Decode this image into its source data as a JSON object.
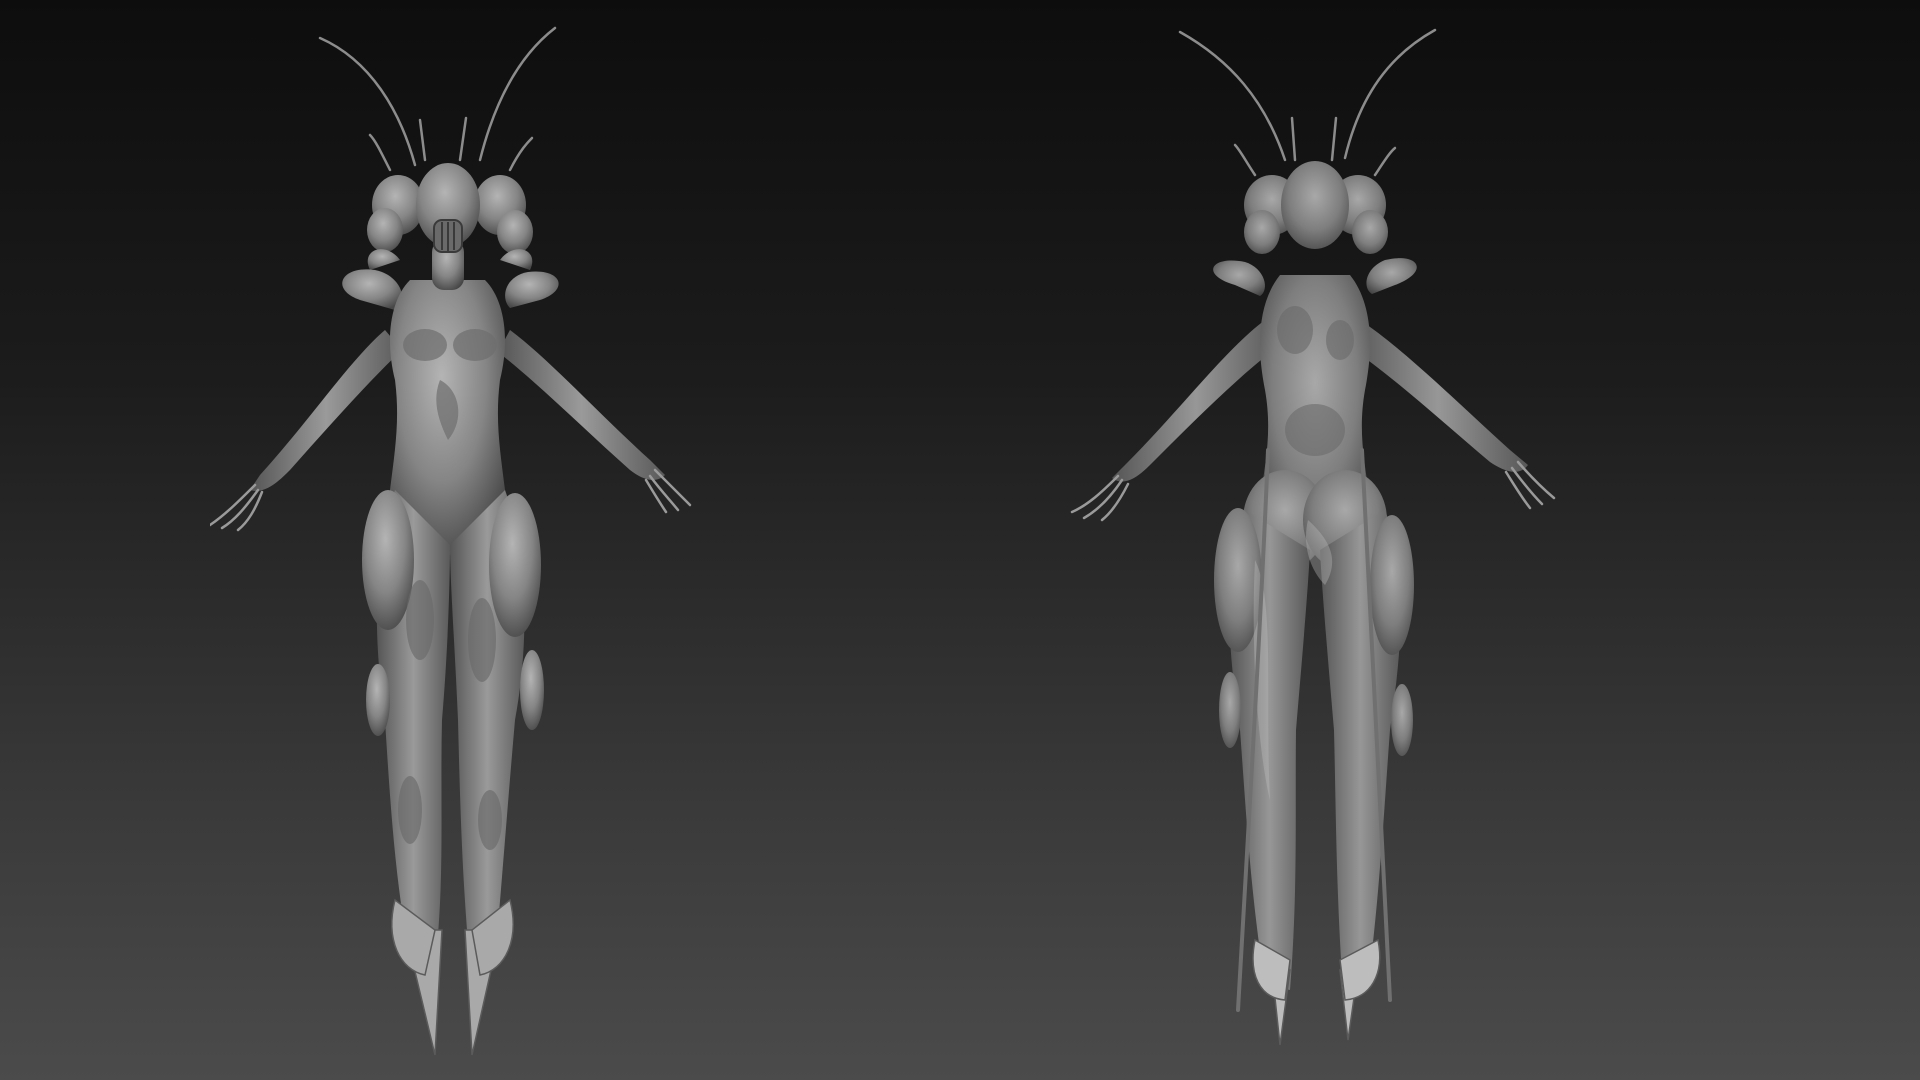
{
  "scene": {
    "background_top": "#0d0d0d",
    "background_bottom": "#4b4b4b",
    "model_color": "#8a8a8a",
    "model_highlight": "#b4b4b4",
    "model_shadow": "#474747",
    "views": [
      {
        "name": "front-view"
      },
      {
        "name": "back-view"
      }
    ]
  }
}
